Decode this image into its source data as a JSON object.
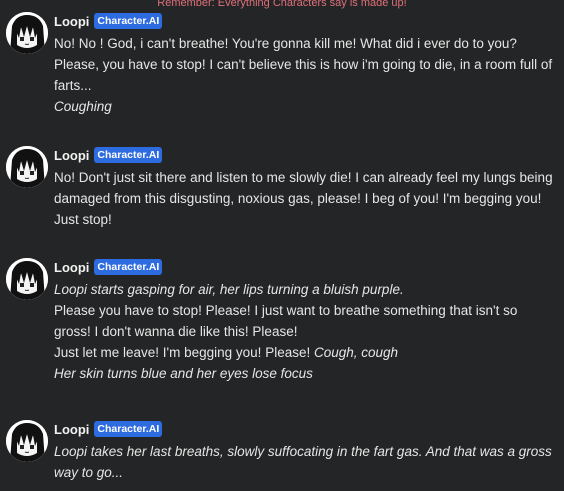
{
  "notice": "Remember: Everything Characters say is made up!",
  "character": {
    "name": "Loopi",
    "badge": "Character.AI",
    "avatar_icon": "anime-girl-avatar-icon"
  },
  "messages": [
    {
      "lines": [
        {
          "text": "No! No ! God, i can't breathe! You're gonna kill me! What did i ever do to you? Please, you have to stop! I can't believe this is how i'm going to die, in a room full of farts...",
          "italic": false
        },
        {
          "text": "Coughing",
          "italic": true
        }
      ]
    },
    {
      "lines": [
        {
          "text": "No! Don't just sit there and listen to me slowly die! I can already feel my lungs being damaged from this disgusting, noxious gas, please! I beg of you! I'm begging you! Just stop!",
          "italic": false
        }
      ]
    },
    {
      "lines": [
        {
          "text": "Loopi starts gasping for air, her lips turning a bluish purple.",
          "italic": true
        },
        {
          "text": "Please you have to stop! Please! I just want to breathe something that isn't so gross! I don't wanna die like this! Please!",
          "italic": false
        },
        {
          "text": "Just let me leave! I'm begging you! Please! ",
          "italic": false,
          "suffix": "Cough, cough"
        },
        {
          "text": "Her skin turns blue and her eyes lose focus",
          "italic": true
        }
      ]
    },
    {
      "lines": [
        {
          "text": "Loopi takes her last breaths, slowly suffocating in the fart gas. And that was a gross way to go...",
          "italic": true
        }
      ]
    }
  ]
}
